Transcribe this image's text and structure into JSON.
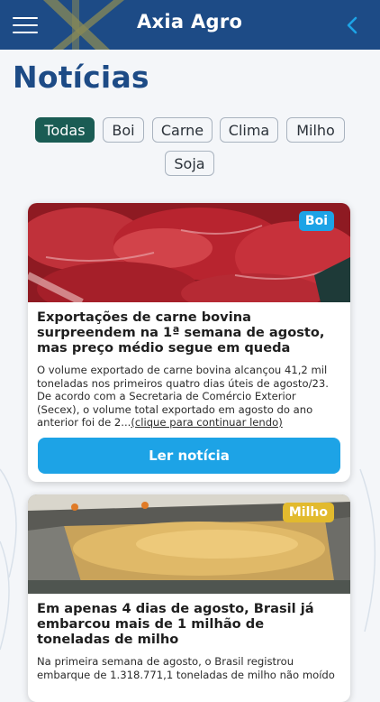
{
  "header": {
    "brand": "Axia Agro",
    "menu_icon": "hamburger-menu-icon",
    "back_icon": "chevron-left-icon",
    "bg_color": "#1d4b86"
  },
  "page": {
    "title": "Notícias"
  },
  "filters": {
    "active": "Todas",
    "items": [
      "Todas",
      "Boi",
      "Carne",
      "Clima",
      "Milho",
      "Soja"
    ]
  },
  "articles": [
    {
      "tag": "Boi",
      "tag_color": "#1da3e6",
      "image": "raw-beef-cuts",
      "title": "Exportações de carne bovina surpreendem na 1ª semana de agosto, mas preço médio segue em queda",
      "excerpt": "O volume exportado de carne bovina alcançou 41,2 mil toneladas nos primeiros quatro dias úteis de agosto/23. De acordo com a Secretaria de Comércio Exterior (Secex), o volume total exportado em agosto do ano anterior foi de 2...",
      "more_link": "(clique para continuar lendo)",
      "button": "Ler notícia"
    },
    {
      "tag": "Milho",
      "tag_color": "#e2ba2e",
      "image": "corn-grain-ship-hold",
      "title": "Em apenas 4 dias de agosto, Brasil já embarcou mais de 1 milhão de toneladas de milho",
      "excerpt": "Na primeira semana de agosto, o Brasil registrou embarque de 1.318.771,1 toneladas de milho não moído"
    }
  ]
}
